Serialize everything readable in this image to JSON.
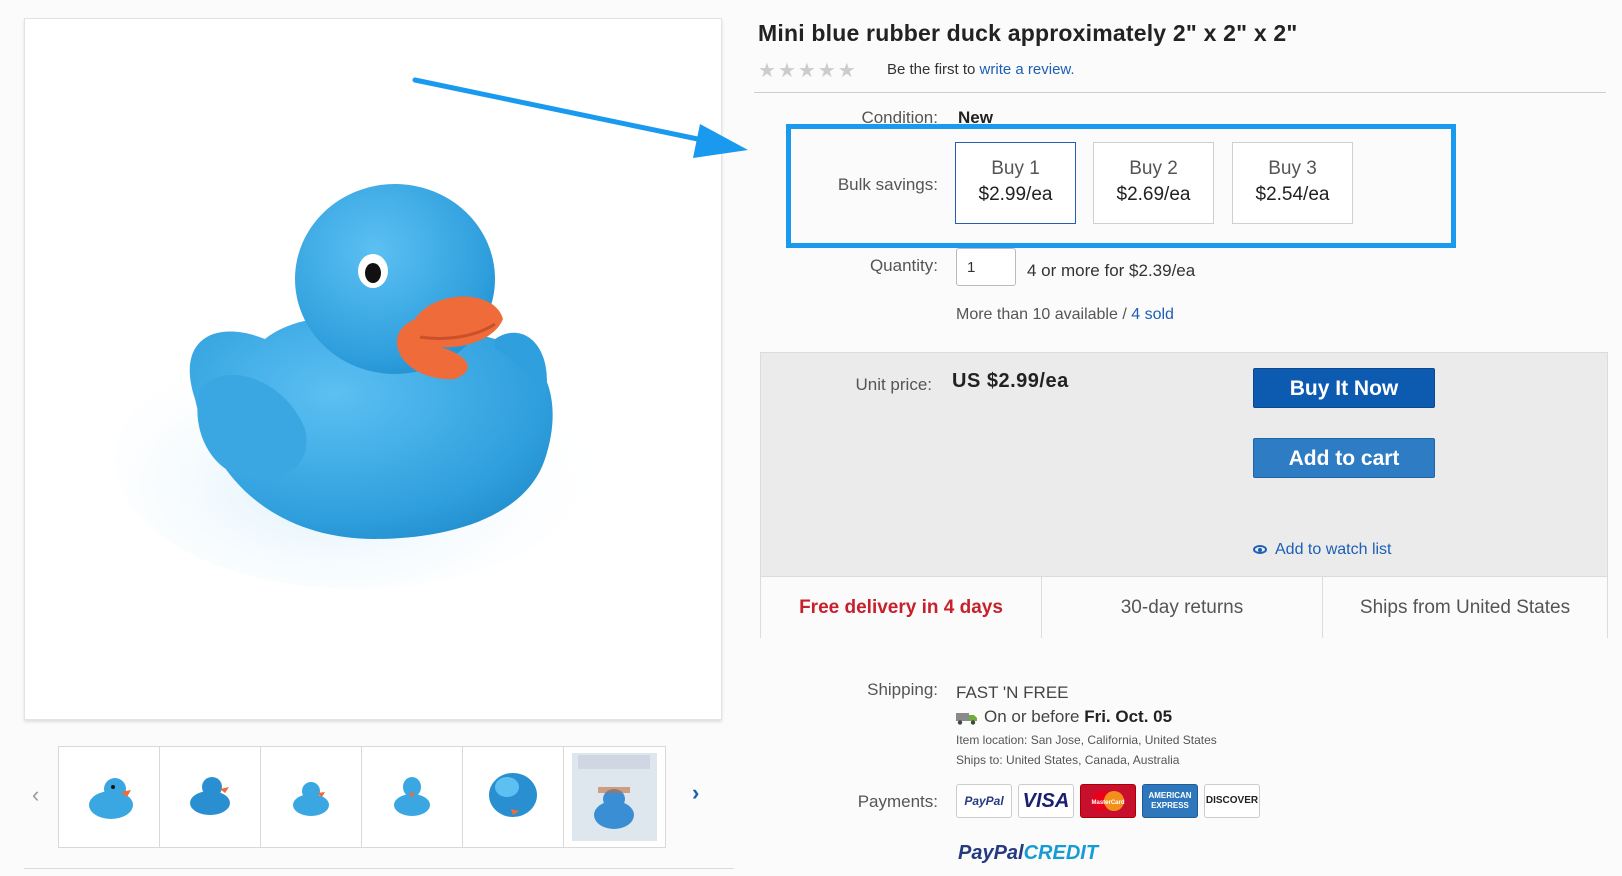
{
  "product": {
    "title": "Mini blue rubber duck approximately 2\" x 2\" x 2\"",
    "review_prefix": "Be the first to",
    "review_link": "write a review."
  },
  "details": {
    "condition_label": "Condition:",
    "condition_value": "New",
    "bulk_label": "Bulk savings:",
    "bulk_options": [
      {
        "qty": "Buy 1",
        "price": "$2.99/ea",
        "selected": true
      },
      {
        "qty": "Buy 2",
        "price": "$2.69/ea",
        "selected": false
      },
      {
        "qty": "Buy 3",
        "price": "$2.54/ea",
        "selected": false
      }
    ],
    "quantity_label": "Quantity:",
    "quantity_value": "1",
    "quantity_note": "4 or more for $2.39/ea",
    "availability": "More than 10 available /",
    "sold_link": "4 sold"
  },
  "purchase": {
    "unit_price_label": "Unit price:",
    "unit_price_value": "US $2.99/ea",
    "buy_now": "Buy It Now",
    "add_to_cart": "Add to cart",
    "watch_list": "Add to watch list"
  },
  "features": {
    "delivery": "Free delivery in 4 days",
    "returns": "30-day returns",
    "ships_from": "Ships from United States"
  },
  "shipping": {
    "label": "Shipping:",
    "method": "FAST 'N FREE",
    "date_prefix": "On or before",
    "date": "Fri. Oct. 05",
    "location": "Item location:  San Jose, California, United States",
    "ships_to": "Ships to:  United States, Canada, Australia"
  },
  "payments": {
    "label": "Payments:",
    "logos": [
      "PayPal",
      "VISA",
      "MasterCard",
      "AMERICAN EXPRESS",
      "DISCOVER"
    ],
    "paypal_credit": [
      "PayPal",
      "CREDIT"
    ]
  },
  "colors": {
    "accent_blue": "#1a9aef",
    "duck_blue": "#3aa7e3",
    "beak": "#ef6c3a",
    "link": "#1c5fb5",
    "buy_now": "#0d5bb0",
    "free_delivery_red": "#c7202d"
  },
  "icons": {
    "gallery_prev": "‹",
    "gallery_next": "›",
    "rating": "★"
  }
}
